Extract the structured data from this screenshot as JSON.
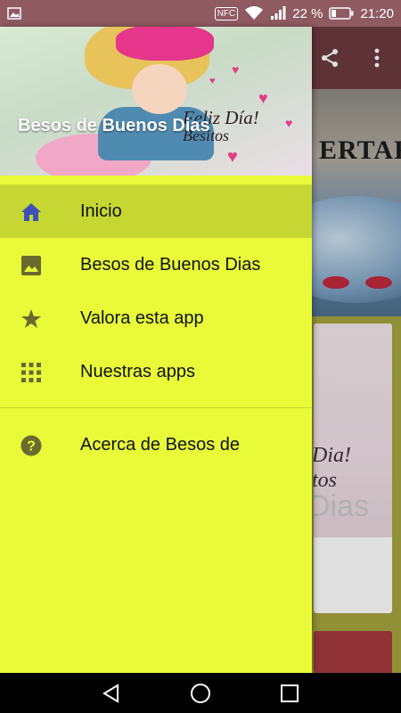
{
  "status_bar": {
    "nfc": "NFC",
    "battery_percent": "22 %",
    "time": "21:20",
    "background_color": "#8f5a60"
  },
  "background_app": {
    "hero_word": "ERTAR",
    "card_text_line1": "Dia!",
    "card_text_line2": "tos",
    "card_dias": "Dias",
    "toolbar_icons": [
      "share-icon",
      "overflow-menu-icon"
    ]
  },
  "drawer": {
    "header_title": "Besos de Buenos Dias",
    "header_script_line1": "Feliz Día!",
    "header_script_line2": "Besitos",
    "background_color": "#e8fa38",
    "active_color": "#c6d632",
    "items": [
      {
        "label": "Inicio",
        "icon": "home-icon",
        "active": true
      },
      {
        "label": "Besos de Buenos Dias",
        "icon": "image-icon",
        "active": false
      },
      {
        "label": "Valora esta app",
        "icon": "star-icon",
        "active": false
      },
      {
        "label": "Nuestras apps",
        "icon": "apps-grid-icon",
        "active": false
      }
    ],
    "secondary_items": [
      {
        "label": "Acerca de Besos de",
        "icon": "help-icon"
      }
    ]
  },
  "nav_bar": {
    "buttons": [
      "back-icon",
      "home-nav-icon",
      "recents-icon"
    ]
  }
}
